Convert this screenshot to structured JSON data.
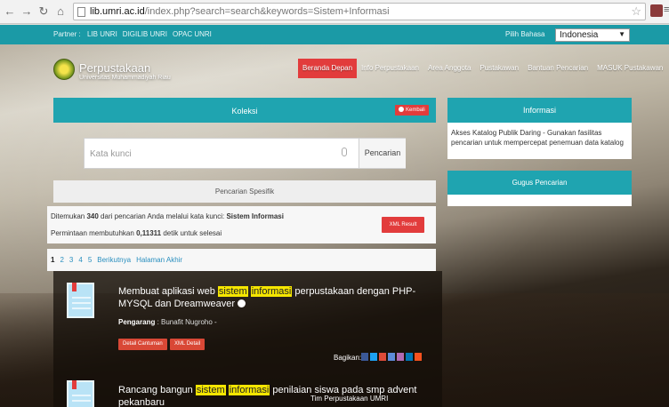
{
  "browser": {
    "url_host": "lib.umri.ac.id",
    "url_rest": "/index.php?search=search&keywords=Sistem+Informasi"
  },
  "partnerbar": {
    "label": "Partner :",
    "links": [
      "LIB UNRI",
      "DIGILIB UNRI",
      "OPAC UNRI"
    ],
    "lang_label": "Pilih Bahasa",
    "lang_value": "Indonesia"
  },
  "header": {
    "title": "Perpustakaan",
    "subtitle": "Universitas Muhammadiyah Riau"
  },
  "nav": {
    "items": [
      "Beranda Depan",
      "Info Perpustakaan",
      "Area Anggota",
      "Pustakawan",
      "Bantuan Pencarian",
      "MASUK Pustakawan"
    ]
  },
  "koleksi": {
    "title": "Koleksi",
    "back_label": "Kembali",
    "search_placeholder": "Kata kunci",
    "search_button": "Pencarian",
    "specific_label": "Pencarian Spesifik"
  },
  "result_info": {
    "prefix": "Ditemukan ",
    "count": "340",
    "middle": " dari pencarian Anda melalui kata kunci: ",
    "keywords": "Sistem Informasi",
    "time_prefix": "Permintaan membutuhkan ",
    "time_value": "0,11311",
    "time_suffix": " detik untuk selesai",
    "xml_button": "XML Result"
  },
  "pager": {
    "pages": [
      "1",
      "2",
      "3",
      "4",
      "5"
    ],
    "next": "Berikutnya",
    "last": "Halaman Akhir"
  },
  "results": [
    {
      "title_before": "Membuat aplikasi web ",
      "hl1": "sistem",
      "hl2": "informasi",
      "title_after": " perpustakaan dengan PHP-MYSQL dan Dreamweaver",
      "author_label": "Pengarang",
      "author": " : Bunafit Nugroho -",
      "detail_button": "Detail Cantuman",
      "xml_button": "XML Detail",
      "share_label": "Bagikan:"
    },
    {
      "title_before": "Rancang bangun ",
      "hl1": "sistem",
      "hl2": "informasi",
      "title_after": " penilaian siswa pada smp advent pekanbaru"
    }
  ],
  "footer": {
    "text": "Tim Perpustakaan UMRI"
  },
  "sidebar": {
    "info_title": "Informasi",
    "info_body": "Akses Katalog Publik Daring - Gunakan fasilitas pencarian untuk mempercepat penemuan data katalog",
    "gugus_title": "Gugus Pencarian"
  },
  "colors": {
    "teal": "#1fa4b0",
    "red": "#e23c3c",
    "highlight": "#f5e600"
  }
}
